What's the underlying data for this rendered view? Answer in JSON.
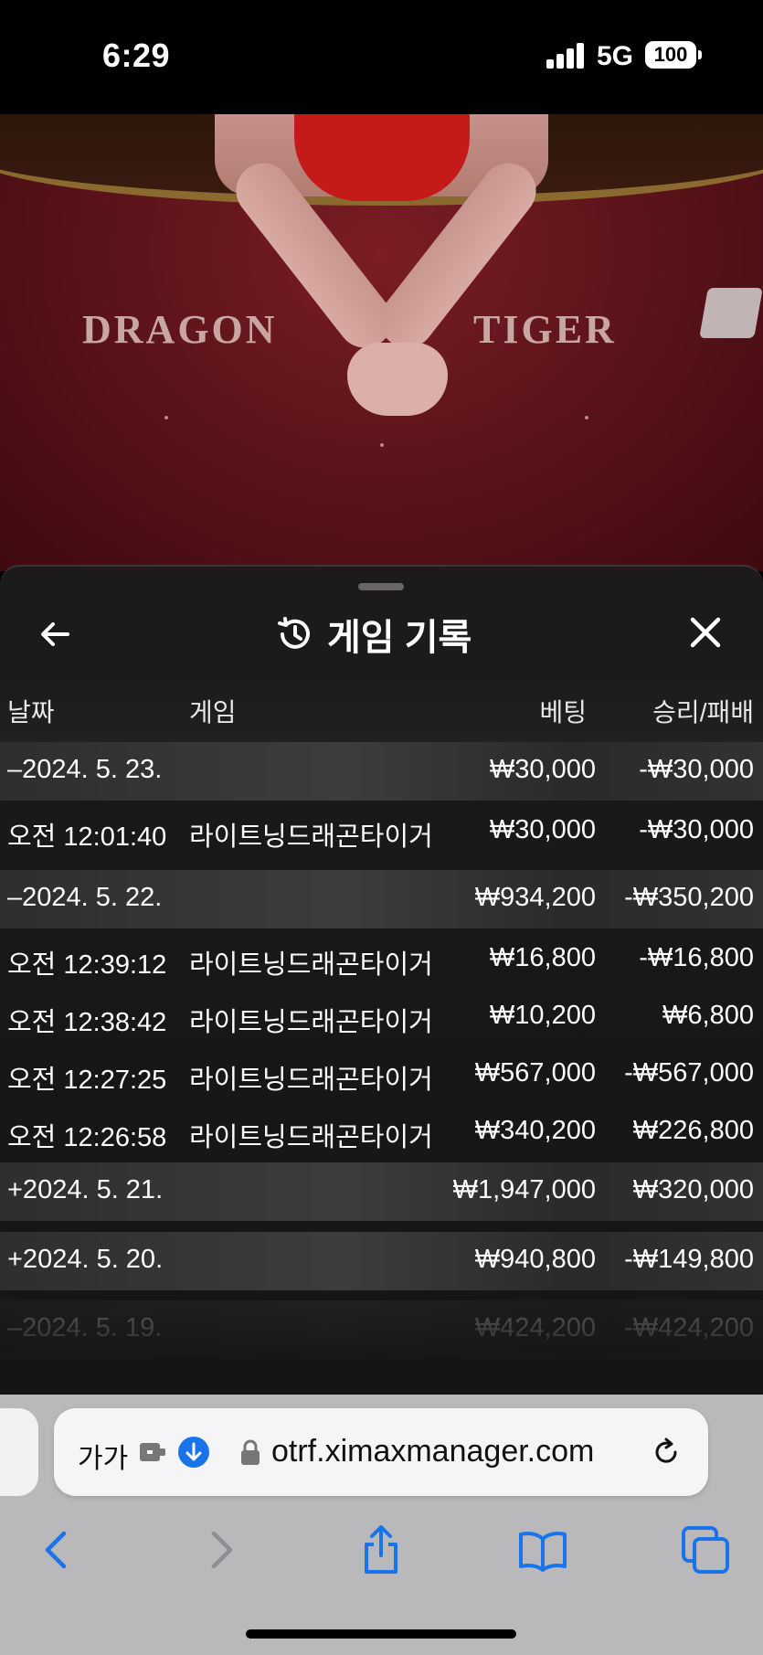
{
  "status": {
    "time": "6:29",
    "network": "5G",
    "battery": "100"
  },
  "video": {
    "left_label": "DRAGON",
    "right_label": "TIGER"
  },
  "sheet": {
    "title": "게임 기록",
    "columns": {
      "date": "날짜",
      "game": "게임",
      "bet": "베팅",
      "win_loss": "승리/패배"
    },
    "rows": [
      {
        "type": "group",
        "date": "–2024. 5. 23.",
        "game": "",
        "bet": "₩30,000",
        "win_loss": "-₩30,000"
      },
      {
        "type": "detail",
        "date": "오전 12:01:40",
        "game": "라이트닝드래곤타이거",
        "bet": "₩30,000",
        "win_loss": "-₩30,000"
      },
      {
        "type": "group",
        "date": "–2024. 5. 22.",
        "game": "",
        "bet": "₩934,200",
        "win_loss": "-₩350,200"
      },
      {
        "type": "detail",
        "date": "오전 12:39:12",
        "game": "라이트닝드래곤타이거",
        "bet": "₩16,800",
        "win_loss": "-₩16,800"
      },
      {
        "type": "detail",
        "date": "오전 12:38:42",
        "game": "라이트닝드래곤타이거",
        "bet": "₩10,200",
        "win_loss": "₩6,800"
      },
      {
        "type": "detail",
        "date": "오전 12:27:25",
        "game": "라이트닝드래곤타이거",
        "bet": "₩567,000",
        "win_loss": "-₩567,000"
      },
      {
        "type": "detail",
        "date": "오전 12:26:58",
        "game": "라이트닝드래곤타이거",
        "bet": "₩340,200",
        "win_loss": "₩226,800"
      },
      {
        "type": "group",
        "date": "+2024. 5. 21.",
        "game": "",
        "bet": "₩1,947,000",
        "win_loss": "₩320,000"
      },
      {
        "type": "group",
        "date": "+2024. 5. 20.",
        "game": "",
        "bet": "₩940,800",
        "win_loss": "-₩149,800"
      },
      {
        "type": "faded",
        "date": "–2024. 5. 19.",
        "game": "",
        "bet": "₩424,200",
        "win_loss": "-₩424,200"
      }
    ]
  },
  "browser": {
    "text_size_label": "가가",
    "url": "otrf.ximaxmanager.com",
    "icons": [
      "extension-icon",
      "download-icon",
      "lock-icon",
      "reload-icon",
      "back-icon",
      "forward-icon",
      "share-icon",
      "bookmarks-icon",
      "tabs-icon"
    ]
  },
  "colors": {
    "accent": "#1a73e8",
    "sheet_bg": "#1c1a1a",
    "felt": "#5e141b"
  }
}
